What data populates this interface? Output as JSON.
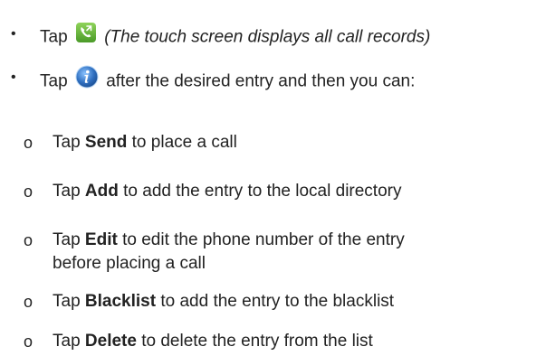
{
  "bullets": [
    {
      "marker": "•",
      "pre": "Tap",
      "icon": "call-log-phone-icon",
      "post": "(The touch screen displays all call records)"
    },
    {
      "marker": "•",
      "pre": "Tap",
      "icon": "info-icon",
      "post": "after the desired entry and then you can:"
    }
  ],
  "sub_items": [
    {
      "marker": "o",
      "pre": "Tap",
      "bold": "Send",
      "post": "to place a call"
    },
    {
      "marker": "o",
      "pre": "Tap",
      "bold": "Add",
      "post": "to add the entry to the local directory"
    },
    {
      "marker": "o",
      "pre": "Tap",
      "bold": "Edit",
      "post": "to edit the phone number of the entry",
      "post2": "before placing a call"
    },
    {
      "marker": "o",
      "pre": "Tap",
      "bold": "Blacklist",
      "post": "to add the entry to the blacklist"
    },
    {
      "marker": "o",
      "pre": "Tap",
      "bold": "Delete",
      "post": "to delete the entry from the list"
    }
  ],
  "colors": {
    "text": "#222222",
    "call_icon_green": "#5fb832",
    "info_icon_blue": "#2f6fc0"
  }
}
